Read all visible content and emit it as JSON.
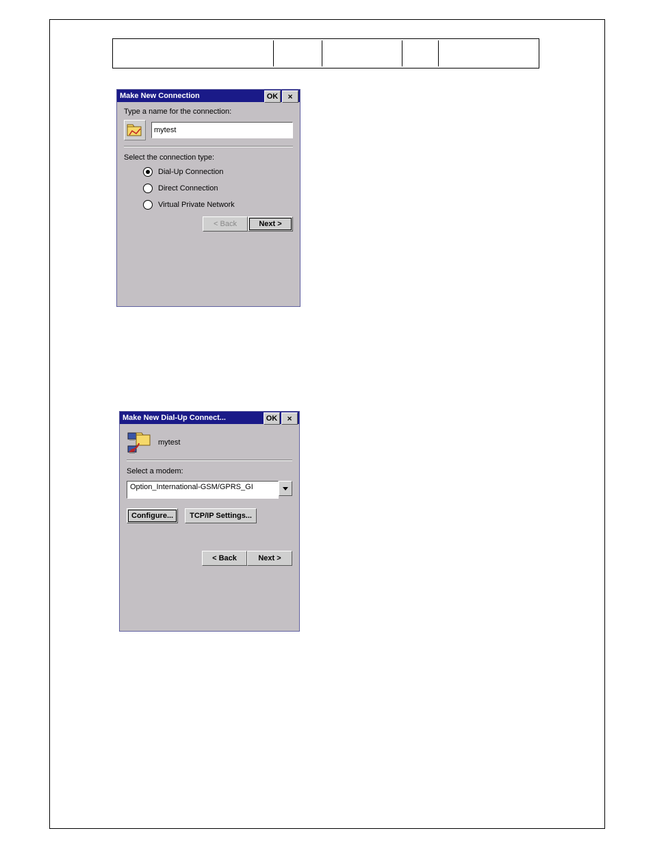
{
  "dlg1": {
    "title": "Make New Connection",
    "ok": "OK",
    "close": "×",
    "name_label": "Type a name for the connection:",
    "name_value": "mytest",
    "select_type_label": "Select the connection type:",
    "radios": {
      "dialup": "Dial-Up Connection",
      "direct": "Direct Connection",
      "vpn": "Virtual Private Network"
    },
    "back": "< Back",
    "next": "Next >"
  },
  "dlg2": {
    "title": "Make New Dial-Up Connect...",
    "ok": "OK",
    "close": "×",
    "conn_name": "mytest",
    "select_modem_label": "Select a modem:",
    "modem_value": "Option_International-GSM/GPRS_GI",
    "configure": "Configure...",
    "tcpip": "TCP/IP Settings...",
    "back": "< Back",
    "next": "Next >"
  }
}
